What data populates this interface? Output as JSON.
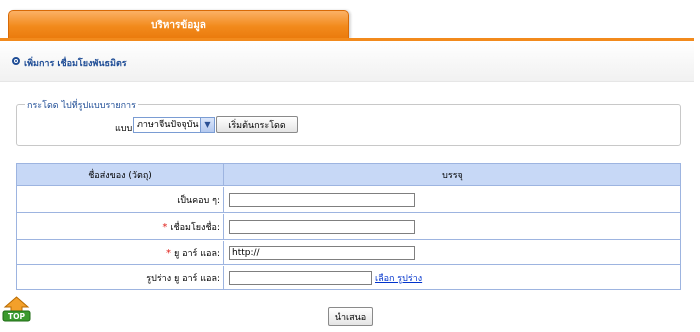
{
  "tab": {
    "label": "บริหารข้อมูล"
  },
  "section": {
    "title": "เพิ่มการ เชื่อมโยงพันธมิตร"
  },
  "jump": {
    "legend": "กระโดด ไปที่รูปแบบรายการ",
    "label": "แบบ:",
    "selected": "ภาษาจีนปัจจุบัน",
    "button": "เริ่มต้นกระโดด"
  },
  "table": {
    "col1": "ชื่อส่งของ (วัตถุ)",
    "col2": "บรรจุ",
    "rows": [
      {
        "label": "เป็นคอบ ๆ:",
        "required": false,
        "value": ""
      },
      {
        "label": "เชื่อมโยงชื่อ:",
        "required": true,
        "value": ""
      },
      {
        "label": "ยู อาร์ แอล:",
        "required": true,
        "value": "http://"
      },
      {
        "label": "รูปร่าง ยู อาร์ แอล:",
        "required": false,
        "value": "",
        "link": "เลือก รูปร่าง"
      }
    ],
    "required_mark": "*"
  },
  "submit": {
    "label": "นำเสนอ"
  },
  "top_button": {
    "label": "TOP"
  },
  "colors": {
    "accent": "#f28a1c",
    "header_bg": "#c7d8f6",
    "title": "#1f4d96"
  }
}
